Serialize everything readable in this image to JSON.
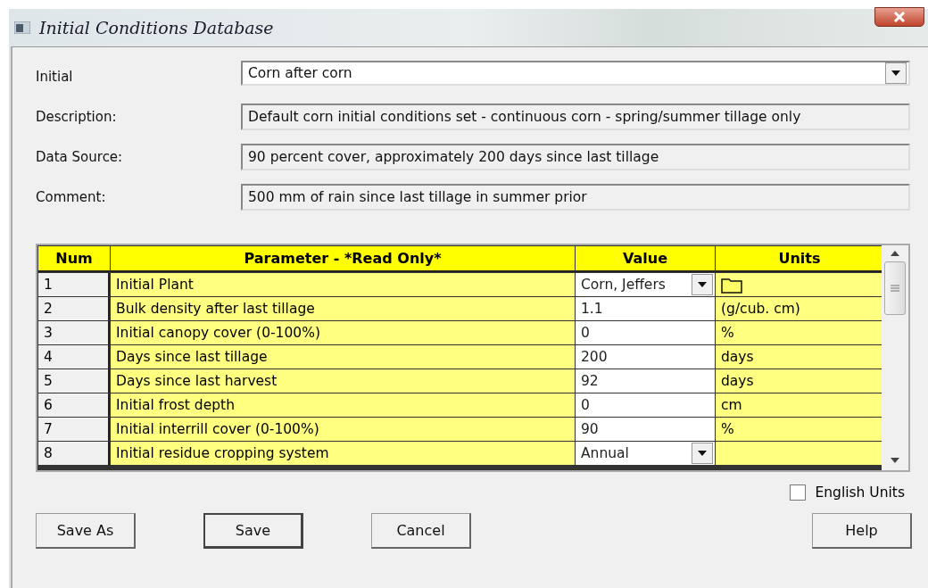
{
  "window": {
    "title": "Initial Conditions Database"
  },
  "fields": [
    {
      "label": "Initial",
      "value": "Corn after corn",
      "kind": "dropdown"
    },
    {
      "label": "Description:",
      "value": "Default corn initial conditions set - continuous corn - spring/summer tillage only",
      "kind": "readonly"
    },
    {
      "label": "Data Source:",
      "value": "90 percent cover, approximately 200 days since last tillage",
      "kind": "readonly"
    },
    {
      "label": "Comment:",
      "value": "500 mm of rain since last tillage in summer prior",
      "kind": "readonly"
    }
  ],
  "table": {
    "columns": [
      "Num",
      "Parameter - *Read Only*",
      "Value",
      "Units"
    ],
    "rows": [
      {
        "num": "1",
        "parameter": "Initial Plant",
        "value": "Corn, Jeffers",
        "kind": "plant_picker"
      },
      {
        "num": "2",
        "parameter": "Bulk density after last tillage",
        "value": "1.1",
        "kind": "text",
        "units": "(g/cub. cm)"
      },
      {
        "num": "3",
        "parameter": "Initial canopy cover (0-100%)",
        "value": "0",
        "kind": "text",
        "units": "%"
      },
      {
        "num": "4",
        "parameter": "Days since last tillage",
        "value": "200",
        "kind": "text",
        "units": "days"
      },
      {
        "num": "5",
        "parameter": "Days since last harvest",
        "value": "92",
        "kind": "text",
        "units": "days"
      },
      {
        "num": "6",
        "parameter": "Initial frost depth",
        "value": "0",
        "kind": "text",
        "units": "cm"
      },
      {
        "num": "7",
        "parameter": "Initial interrill cover (0-100%)",
        "value": "90",
        "kind": "text",
        "units": "%"
      },
      {
        "num": "8",
        "parameter": "Initial residue cropping system",
        "value": "Annual",
        "kind": "dropdown"
      }
    ]
  },
  "english_units": {
    "label": "English Units",
    "checked": false
  },
  "buttons": [
    {
      "label": "Save As",
      "default": false
    },
    {
      "label": "Save",
      "default": true
    },
    {
      "label": "Cancel",
      "default": false
    },
    {
      "label": "Help",
      "default": false
    }
  ]
}
